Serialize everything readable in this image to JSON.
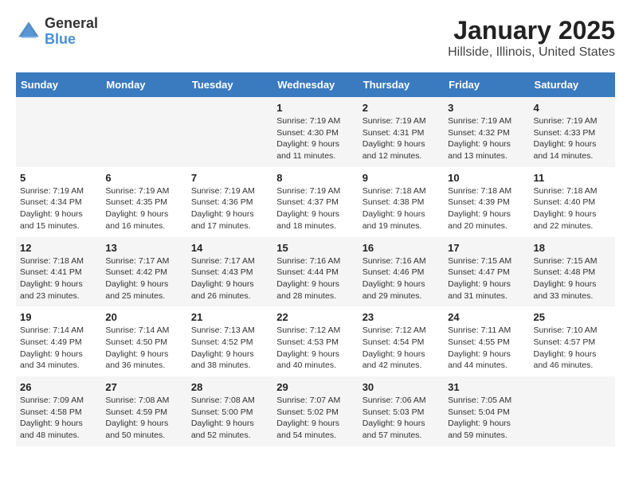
{
  "header": {
    "logo_general": "General",
    "logo_blue": "Blue",
    "title": "January 2025",
    "subtitle": "Hillside, Illinois, United States"
  },
  "weekdays": [
    "Sunday",
    "Monday",
    "Tuesday",
    "Wednesday",
    "Thursday",
    "Friday",
    "Saturday"
  ],
  "weeks": [
    [
      {
        "day": "",
        "info": ""
      },
      {
        "day": "",
        "info": ""
      },
      {
        "day": "",
        "info": ""
      },
      {
        "day": "1",
        "info": "Sunrise: 7:19 AM\nSunset: 4:30 PM\nDaylight: 9 hours\nand 11 minutes."
      },
      {
        "day": "2",
        "info": "Sunrise: 7:19 AM\nSunset: 4:31 PM\nDaylight: 9 hours\nand 12 minutes."
      },
      {
        "day": "3",
        "info": "Sunrise: 7:19 AM\nSunset: 4:32 PM\nDaylight: 9 hours\nand 13 minutes."
      },
      {
        "day": "4",
        "info": "Sunrise: 7:19 AM\nSunset: 4:33 PM\nDaylight: 9 hours\nand 14 minutes."
      }
    ],
    [
      {
        "day": "5",
        "info": "Sunrise: 7:19 AM\nSunset: 4:34 PM\nDaylight: 9 hours\nand 15 minutes."
      },
      {
        "day": "6",
        "info": "Sunrise: 7:19 AM\nSunset: 4:35 PM\nDaylight: 9 hours\nand 16 minutes."
      },
      {
        "day": "7",
        "info": "Sunrise: 7:19 AM\nSunset: 4:36 PM\nDaylight: 9 hours\nand 17 minutes."
      },
      {
        "day": "8",
        "info": "Sunrise: 7:19 AM\nSunset: 4:37 PM\nDaylight: 9 hours\nand 18 minutes."
      },
      {
        "day": "9",
        "info": "Sunrise: 7:18 AM\nSunset: 4:38 PM\nDaylight: 9 hours\nand 19 minutes."
      },
      {
        "day": "10",
        "info": "Sunrise: 7:18 AM\nSunset: 4:39 PM\nDaylight: 9 hours\nand 20 minutes."
      },
      {
        "day": "11",
        "info": "Sunrise: 7:18 AM\nSunset: 4:40 PM\nDaylight: 9 hours\nand 22 minutes."
      }
    ],
    [
      {
        "day": "12",
        "info": "Sunrise: 7:18 AM\nSunset: 4:41 PM\nDaylight: 9 hours\nand 23 minutes."
      },
      {
        "day": "13",
        "info": "Sunrise: 7:17 AM\nSunset: 4:42 PM\nDaylight: 9 hours\nand 25 minutes."
      },
      {
        "day": "14",
        "info": "Sunrise: 7:17 AM\nSunset: 4:43 PM\nDaylight: 9 hours\nand 26 minutes."
      },
      {
        "day": "15",
        "info": "Sunrise: 7:16 AM\nSunset: 4:44 PM\nDaylight: 9 hours\nand 28 minutes."
      },
      {
        "day": "16",
        "info": "Sunrise: 7:16 AM\nSunset: 4:46 PM\nDaylight: 9 hours\nand 29 minutes."
      },
      {
        "day": "17",
        "info": "Sunrise: 7:15 AM\nSunset: 4:47 PM\nDaylight: 9 hours\nand 31 minutes."
      },
      {
        "day": "18",
        "info": "Sunrise: 7:15 AM\nSunset: 4:48 PM\nDaylight: 9 hours\nand 33 minutes."
      }
    ],
    [
      {
        "day": "19",
        "info": "Sunrise: 7:14 AM\nSunset: 4:49 PM\nDaylight: 9 hours\nand 34 minutes."
      },
      {
        "day": "20",
        "info": "Sunrise: 7:14 AM\nSunset: 4:50 PM\nDaylight: 9 hours\nand 36 minutes."
      },
      {
        "day": "21",
        "info": "Sunrise: 7:13 AM\nSunset: 4:52 PM\nDaylight: 9 hours\nand 38 minutes."
      },
      {
        "day": "22",
        "info": "Sunrise: 7:12 AM\nSunset: 4:53 PM\nDaylight: 9 hours\nand 40 minutes."
      },
      {
        "day": "23",
        "info": "Sunrise: 7:12 AM\nSunset: 4:54 PM\nDaylight: 9 hours\nand 42 minutes."
      },
      {
        "day": "24",
        "info": "Sunrise: 7:11 AM\nSunset: 4:55 PM\nDaylight: 9 hours\nand 44 minutes."
      },
      {
        "day": "25",
        "info": "Sunrise: 7:10 AM\nSunset: 4:57 PM\nDaylight: 9 hours\nand 46 minutes."
      }
    ],
    [
      {
        "day": "26",
        "info": "Sunrise: 7:09 AM\nSunset: 4:58 PM\nDaylight: 9 hours\nand 48 minutes."
      },
      {
        "day": "27",
        "info": "Sunrise: 7:08 AM\nSunset: 4:59 PM\nDaylight: 9 hours\nand 50 minutes."
      },
      {
        "day": "28",
        "info": "Sunrise: 7:08 AM\nSunset: 5:00 PM\nDaylight: 9 hours\nand 52 minutes."
      },
      {
        "day": "29",
        "info": "Sunrise: 7:07 AM\nSunset: 5:02 PM\nDaylight: 9 hours\nand 54 minutes."
      },
      {
        "day": "30",
        "info": "Sunrise: 7:06 AM\nSunset: 5:03 PM\nDaylight: 9 hours\nand 57 minutes."
      },
      {
        "day": "31",
        "info": "Sunrise: 7:05 AM\nSunset: 5:04 PM\nDaylight: 9 hours\nand 59 minutes."
      },
      {
        "day": "",
        "info": ""
      }
    ]
  ]
}
